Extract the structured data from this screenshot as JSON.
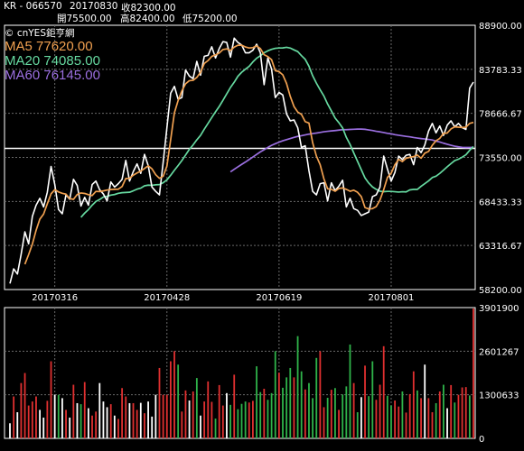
{
  "header": {
    "code": "KR - 066570",
    "date": "20170830",
    "close": "收82300.00",
    "open": "開75500.00",
    "high": "高82400.00",
    "low": "低75200.00"
  },
  "brand": "© cnYES鉅亨網",
  "chart_data": [
    {
      "type": "line",
      "legend": [
        {
          "label": "MA5 77620.00",
          "color": "#f0a050"
        },
        {
          "label": "MA20 74085.00",
          "color": "#66d9a0"
        },
        {
          "label": "MA60 76145.00",
          "color": "#9b6fe0"
        }
      ],
      "x_tick_labels": [
        "20170316",
        "20170428",
        "20170619",
        "20170801"
      ],
      "y_tick_labels": [
        "88900.00",
        "83783.33",
        "78666.67",
        "73550.00",
        "68433.33",
        "63316.67",
        "58200.00"
      ],
      "ylim": [
        58200,
        88900
      ],
      "reference_line": 74600,
      "n": 125,
      "tick_index": [
        12,
        42,
        72,
        102
      ],
      "series": [
        {
          "name": "Close",
          "color": "#ffffff",
          "values": [
            58900,
            60600,
            60000,
            62300,
            64900,
            63500,
            66700,
            68000,
            68800,
            67800,
            69500,
            72500,
            70400,
            67500,
            67000,
            69200,
            68700,
            71000,
            70300,
            67900,
            68900,
            68000,
            70400,
            70800,
            69800,
            69300,
            68500,
            70700,
            70100,
            70500,
            71000,
            73200,
            70800,
            71900,
            72800,
            71700,
            73900,
            72600,
            70100,
            69600,
            69200,
            73000,
            77000,
            81000,
            81800,
            80300,
            80500,
            83700,
            83000,
            82700,
            84700,
            83100,
            85300,
            85400,
            86400,
            85100,
            86200,
            87000,
            86900,
            85200,
            87400,
            86900,
            86600,
            85700,
            85700,
            86000,
            86700,
            85700,
            82000,
            85100,
            83800,
            80500,
            81100,
            80800,
            78600,
            77800,
            77900,
            77000,
            74700,
            74900,
            72000,
            69600,
            69200,
            70500,
            70600,
            68500,
            70600,
            69700,
            70200,
            70900,
            67800,
            68800,
            67600,
            67400,
            66800,
            67000,
            67200,
            69000,
            69200,
            70100,
            73700,
            72200,
            70800,
            71800,
            73700,
            73300,
            73800,
            73900,
            72700,
            74700,
            74100,
            75000,
            76600,
            77500,
            76400,
            77200,
            76100,
            77300,
            77800,
            77100,
            77500,
            77000,
            76800,
            81600,
            82300
          ]
        },
        {
          "name": "MA5",
          "color": "#f0a050",
          "values": [
            null,
            null,
            null,
            null,
            61140,
            62260,
            63480,
            65080,
            66380,
            66960,
            68160,
            69320,
            69800,
            69540,
            69380,
            69280,
            68760,
            68680,
            69240,
            69420,
            69360,
            69220,
            69120,
            69600,
            69580,
            69660,
            69760,
            69820,
            69840,
            69860,
            70160,
            71100,
            71120,
            71480,
            71740,
            71960,
            72260,
            72580,
            72220,
            71540,
            71120,
            71360,
            72540,
            75600,
            78720,
            80160,
            81280,
            82100,
            82460,
            82500,
            82840,
            83440,
            84460,
            84800,
            85280,
            85460,
            85680,
            86080,
            86160,
            85960,
            86360,
            86580,
            86580,
            86380,
            86260,
            86300,
            86500,
            86200,
            85480,
            85260,
            84900,
            83620,
            83520,
            83140,
            82140,
            80640,
            79460,
            78820,
            78540,
            77700,
            77540,
            75240,
            73700,
            72700,
            71060,
            69900,
            69840,
            69620,
            69940,
            70000,
            69840,
            69620,
            69740,
            69500,
            69000,
            67720,
            67560,
            67600,
            67840,
            68600,
            69800,
            71220,
            71720,
            72700,
            73320,
            73060,
            73460,
            73560,
            73640,
            73820,
            73460,
            74040,
            74240,
            74960,
            75480,
            75760,
            76340,
            76380,
            76860,
            77100,
            77060,
            77020,
            77060,
            77500,
            77620
          ]
        },
        {
          "name": "MA20",
          "color": "#66d9a0",
          "values": [
            null,
            null,
            null,
            null,
            null,
            null,
            null,
            null,
            null,
            null,
            null,
            null,
            null,
            null,
            null,
            null,
            null,
            null,
            null,
            66590,
            67080,
            67490,
            68000,
            68430,
            68660,
            68950,
            69030,
            69170,
            69240,
            69380,
            69450,
            69480,
            69500,
            69670,
            69860,
            69980,
            70250,
            70330,
            70310,
            70370,
            70390,
            70610,
            70940,
            71470,
            72060,
            72610,
            73180,
            73830,
            74480,
            75000,
            75590,
            76110,
            76830,
            77500,
            78180,
            78840,
            79470,
            80190,
            80930,
            81670,
            82280,
            82980,
            83440,
            83800,
            84130,
            84640,
            85070,
            85360,
            85710,
            85930,
            86100,
            86220,
            86260,
            86270,
            86340,
            86250,
            86040,
            85840,
            85370,
            84940,
            84140,
            83030,
            82170,
            81400,
            80680,
            79750,
            78950,
            78120,
            77590,
            76980,
            75880,
            75060,
            74060,
            73090,
            72120,
            71170,
            70570,
            70120,
            69840,
            69620,
            69570,
            69600,
            69600,
            69560,
            69520,
            69560,
            69540,
            69780,
            69830,
            69830,
            70190,
            70500,
            70820,
            71210,
            71370,
            71690,
            72070,
            72460,
            72830,
            73180,
            73340,
            73580,
            73860,
            74370,
            74810
          ]
        },
        {
          "name": "MA60",
          "color": "#9b6fe0",
          "values": [
            null,
            null,
            null,
            null,
            null,
            null,
            null,
            null,
            null,
            null,
            null,
            null,
            null,
            null,
            null,
            null,
            null,
            null,
            null,
            null,
            null,
            null,
            null,
            null,
            null,
            null,
            null,
            null,
            null,
            null,
            null,
            null,
            null,
            null,
            null,
            null,
            null,
            null,
            null,
            null,
            null,
            null,
            null,
            null,
            null,
            null,
            null,
            null,
            null,
            null,
            null,
            null,
            null,
            null,
            null,
            null,
            null,
            null,
            null,
            71870,
            72170,
            72460,
            72740,
            73010,
            73300,
            73600,
            73900,
            74190,
            74440,
            74710,
            74950,
            75140,
            75320,
            75480,
            75610,
            75740,
            75870,
            75990,
            76070,
            76160,
            76250,
            76320,
            76380,
            76450,
            76530,
            76580,
            76630,
            76670,
            76720,
            76770,
            76770,
            76800,
            76820,
            76840,
            76840,
            76810,
            76740,
            76670,
            76580,
            76520,
            76440,
            76350,
            76290,
            76190,
            76120,
            76060,
            75990,
            75940,
            75860,
            75800,
            75740,
            75690,
            75640,
            75570,
            75440,
            75340,
            75200,
            75080,
            74960,
            74850,
            74780,
            74720,
            74700,
            74710,
            74720
          ]
        }
      ]
    },
    {
      "type": "bar",
      "y_tick_labels": [
        "3901900",
        "2601267",
        "1300633",
        "0"
      ],
      "ylim": [
        0,
        3901900
      ],
      "volume": [
        450000,
        1250000,
        780000,
        1650000,
        1950000,
        980000,
        1100000,
        1250000,
        850000,
        620000,
        1120000,
        2300000,
        1300000,
        1300000,
        1200000,
        850000,
        620000,
        1600000,
        1050000,
        1020000,
        1680000,
        900000,
        680000,
        800000,
        1650000,
        1100000,
        930000,
        1020000,
        680000,
        580000,
        1500000,
        1250000,
        1050000,
        1050000,
        850000,
        1060000,
        750000,
        1100000,
        650000,
        1300000,
        2100000,
        1300000,
        1300000,
        2300000,
        2600000,
        2200000,
        800000,
        1430000,
        1130000,
        1400000,
        1800000,
        680000,
        1100000,
        1700000,
        1090000,
        590000,
        1590000,
        980000,
        1350000,
        1000000,
        1900000,
        870000,
        1030000,
        1100000,
        1070000,
        1120000,
        2150000,
        1380000,
        1480000,
        1150000,
        1350000,
        2600000,
        1960000,
        1510000,
        1820000,
        2100000,
        1820000,
        3050000,
        2000000,
        1460000,
        1650000,
        1200000,
        2400000,
        2600000,
        930000,
        1210000,
        1450000,
        1500000,
        850000,
        1310000,
        1550000,
        2800000,
        1650000,
        780000,
        1230000,
        2170000,
        1260000,
        2300000,
        1150000,
        1600000,
        2750000,
        1270000,
        980000,
        1130000,
        950000,
        1400000,
        770000,
        1320000,
        2000000,
        1430000,
        1200000,
        2200000,
        1200000,
        780000,
        1050000,
        1400000,
        1600000,
        900000,
        1590000,
        1070000,
        1300000,
        1520000,
        1530000,
        1280000,
        3950000
      ],
      "volume_colors": [
        "w",
        "r",
        "w",
        "r",
        "r",
        "r",
        "r",
        "r",
        "w",
        "w",
        "r",
        "r",
        "w",
        "g",
        "w",
        "r",
        "w",
        "r",
        "w",
        "g",
        "r",
        "w",
        "r",
        "r",
        "w",
        "w",
        "w",
        "r",
        "w",
        "r",
        "r",
        "r",
        "w",
        "r",
        "r",
        "w",
        "r",
        "w",
        "w",
        "w",
        "r",
        "r",
        "r",
        "r",
        "r",
        "g",
        "r",
        "r",
        "w",
        "r",
        "g",
        "w",
        "r",
        "r",
        "r",
        "g",
        "r",
        "r",
        "w",
        "g",
        "r",
        "g",
        "g",
        "g",
        "r",
        "r",
        "g",
        "g",
        "r",
        "g",
        "g",
        "g",
        "r",
        "g",
        "g",
        "g",
        "r",
        "g",
        "g",
        "r",
        "g",
        "g",
        "g",
        "r",
        "r",
        "g",
        "r",
        "g",
        "r",
        "g",
        "g",
        "g",
        "r",
        "g",
        "w",
        "r",
        "g",
        "g",
        "r",
        "r",
        "r",
        "g",
        "g",
        "r",
        "r",
        "g",
        "r",
        "r",
        "r",
        "g",
        "r",
        "w",
        "r",
        "r",
        "g",
        "r",
        "g",
        "w",
        "r",
        "g",
        "r",
        "r",
        "r",
        "g",
        "r"
      ]
    }
  ]
}
